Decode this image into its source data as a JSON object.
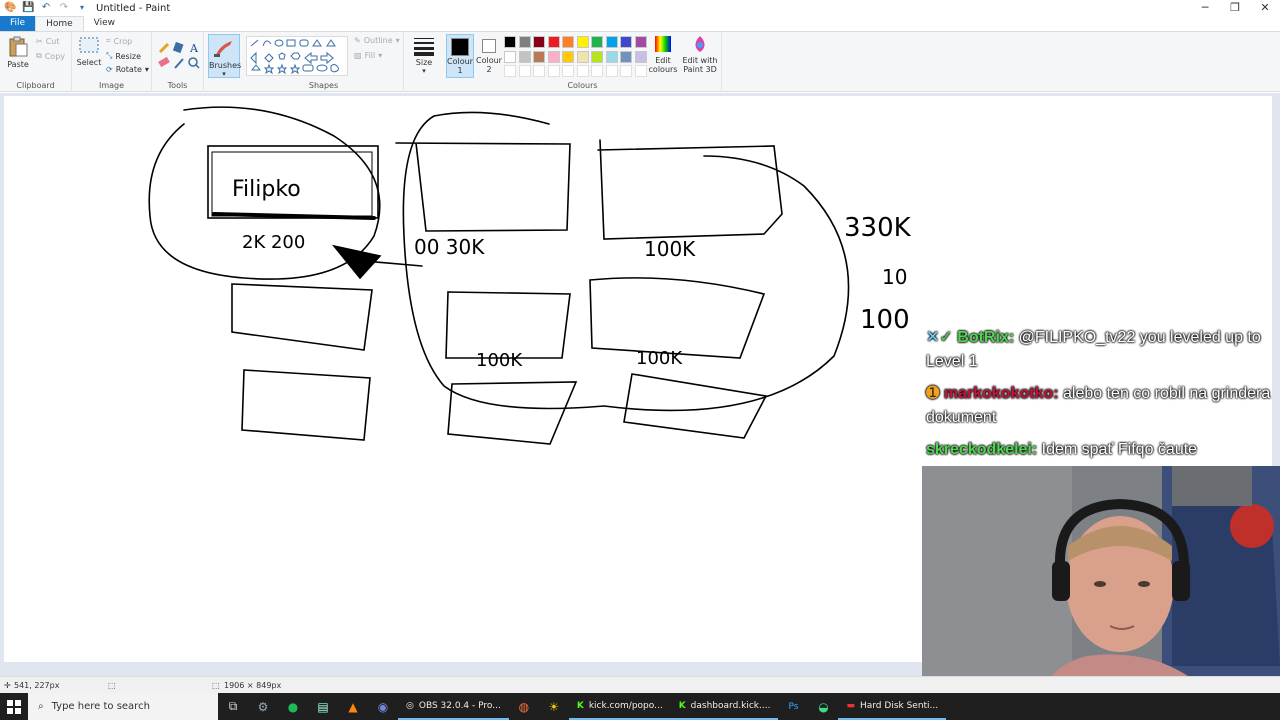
{
  "window": {
    "title": "Untitled - Paint",
    "controls": [
      "minimize",
      "maximize",
      "close"
    ]
  },
  "tabs": [
    {
      "label": "File"
    },
    {
      "label": "Home"
    },
    {
      "label": "View"
    }
  ],
  "ribbon": {
    "clipboard": {
      "paste": "Paste",
      "cut": "Cut",
      "copy": "Copy",
      "group": "Clipboard"
    },
    "image": {
      "select": "Select",
      "crop": "Crop",
      "resize": "Resize",
      "rotate": "Rotate",
      "group": "Image"
    },
    "tools": {
      "group": "Tools"
    },
    "brushes": {
      "label": "Brushes"
    },
    "shapes": {
      "outline": "Outline",
      "fill": "Fill",
      "group": "Shapes"
    },
    "size": {
      "label": "Size"
    },
    "colours": {
      "colour1": "Colour\n1",
      "colour1_a": "Colour",
      "colour1_b": "1",
      "colour2_a": "Colour",
      "colour2_b": "2",
      "edit_a": "Edit",
      "edit_b": "colours",
      "paint3d_a": "Edit with",
      "paint3d_b": "Paint 3D",
      "group": "Colours",
      "palette_row1": [
        "#000000",
        "#7f7f7f",
        "#880015",
        "#ed1c24",
        "#ff7f27",
        "#fff200",
        "#22b14c",
        "#00a2e8",
        "#3f48cc",
        "#a349a4"
      ],
      "palette_row2": [
        "#ffffff",
        "#c3c3c3",
        "#b97a57",
        "#ffaec9",
        "#ffc90e",
        "#efe4b0",
        "#b5e61d",
        "#99d9ea",
        "#7092be",
        "#c8bfe7"
      ]
    }
  },
  "canvas": {
    "labels": {
      "filipko": "Filipko",
      "l1": "2K 200",
      "l2": "00  30K",
      "l3": "100K",
      "l4": "330K",
      "l5": "10",
      "l6": "100",
      "l7": "100K",
      "l8": "100K"
    }
  },
  "statusbar": {
    "cursor": "541, 227px",
    "canvas_size": "1906 × 849px"
  },
  "chat": [
    {
      "user": "BotRix:",
      "user_color": "#4fd64f",
      "text": "@FILIPKO_tv22 you leveled up to Level 1"
    },
    {
      "user": "markokokotko:",
      "user_color": "#c0143c",
      "text": "alebo ten co robil na grindera dokument"
    },
    {
      "user": "skreckodkelei:",
      "user_color": "#4fd64f",
      "text": "Idem spať Fifqo čaute"
    }
  ],
  "taskbar": {
    "search_placeholder": "Type here to search",
    "apps": [
      {
        "label": "OBS 32.0.4 - Pro..."
      },
      {
        "label": "kick.com/popo..."
      },
      {
        "label": "dashboard.kick...."
      },
      {
        "label": "Hard Disk Senti..."
      }
    ]
  }
}
